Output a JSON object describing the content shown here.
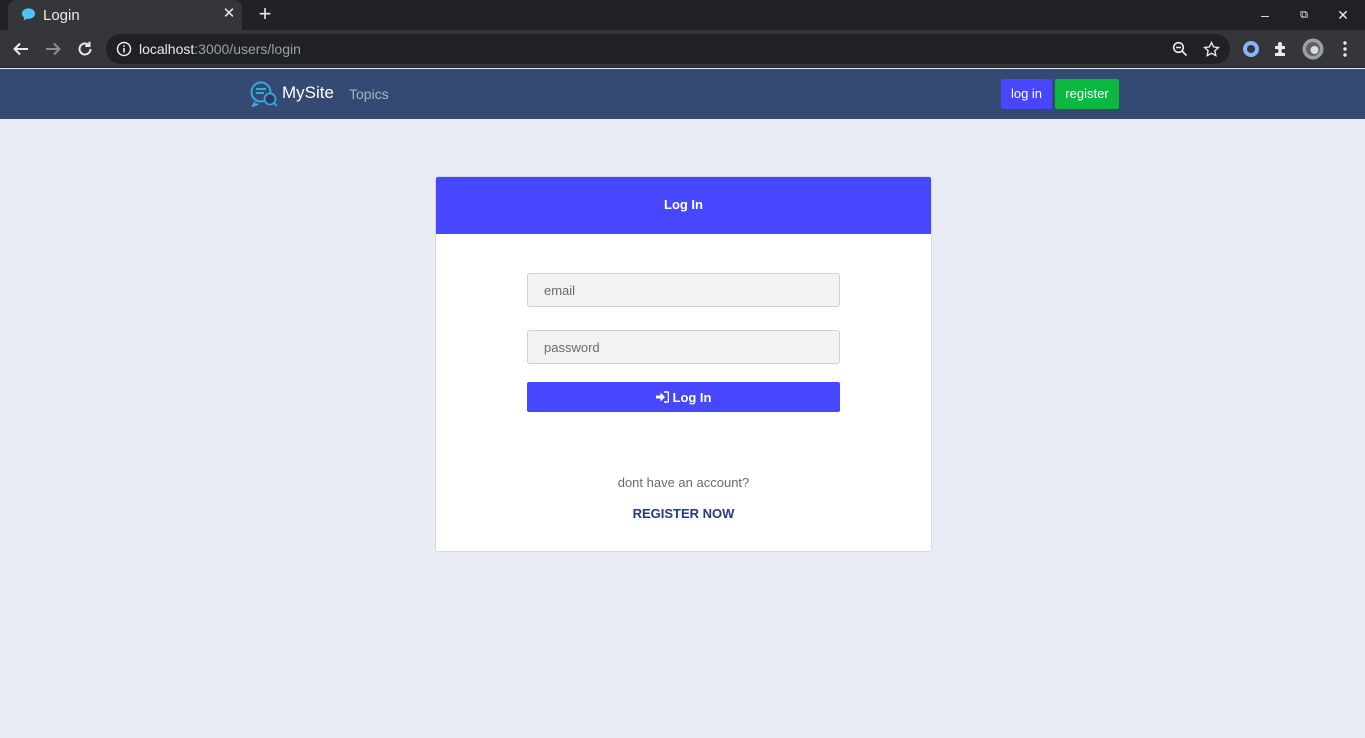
{
  "browser": {
    "tab_title": "Login",
    "url_host": "localhost",
    "url_path": ":3000/users/login"
  },
  "site": {
    "brand": "MySite",
    "nav_topics": "Topics",
    "login_button": "log in",
    "register_button": "register"
  },
  "login_card": {
    "header": "Log In",
    "email_placeholder": "email",
    "password_placeholder": "password",
    "submit_label": "Log In",
    "no_account_prompt": "dont have an account?",
    "register_link": "REGISTER NOW"
  },
  "colors": {
    "primary": "#4747ff",
    "success": "#0cb83f",
    "navbar": "#344a72",
    "background": "#e9ecf4"
  }
}
